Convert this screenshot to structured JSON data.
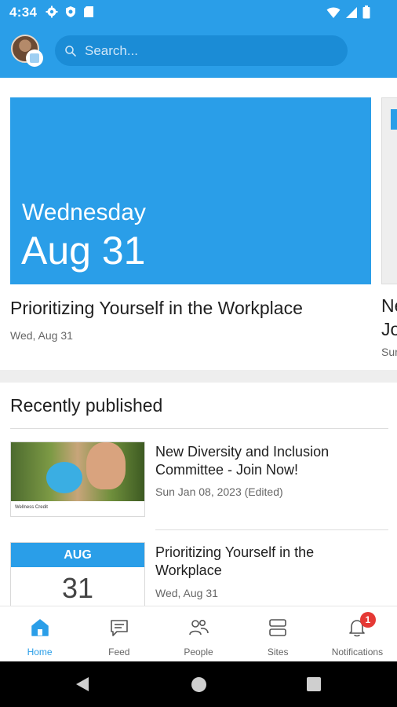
{
  "status_bar": {
    "time": "4:34",
    "left_icons": [
      "gear-icon",
      "shield-icon",
      "sd-card-icon"
    ],
    "right_icons": [
      "wifi-icon",
      "signal-icon",
      "battery-icon"
    ]
  },
  "header": {
    "search_placeholder": "Search...",
    "accent_color": "#2a9ee8"
  },
  "carousel": {
    "cards": [
      {
        "day_of_week": "Wednesday",
        "date": "Aug 31",
        "title": "Prioritizing Yourself in the Workplace",
        "meta": "Wed, Aug 31"
      },
      {
        "title": "Ne\nJo",
        "meta": "Sur"
      }
    ]
  },
  "recently_published": {
    "section_title": "Recently published",
    "items": [
      {
        "title": "New Diversity and Inclusion Committee - Join Now!",
        "meta": "Sun Jan 08, 2023 (Edited)",
        "thumb_caption": "Wellness Credit"
      },
      {
        "title": "Prioritizing Yourself in the Workplace",
        "meta": "Wed, Aug 31",
        "calendar_month": "AUG",
        "calendar_day": "31"
      }
    ]
  },
  "bottom_nav": {
    "items": [
      {
        "label": "Home",
        "icon": "home-icon",
        "active": true
      },
      {
        "label": "Feed",
        "icon": "chat-icon"
      },
      {
        "label": "People",
        "icon": "people-icon"
      },
      {
        "label": "Sites",
        "icon": "sites-icon"
      },
      {
        "label": "Notifications",
        "icon": "bell-icon",
        "badge": "1"
      }
    ]
  }
}
